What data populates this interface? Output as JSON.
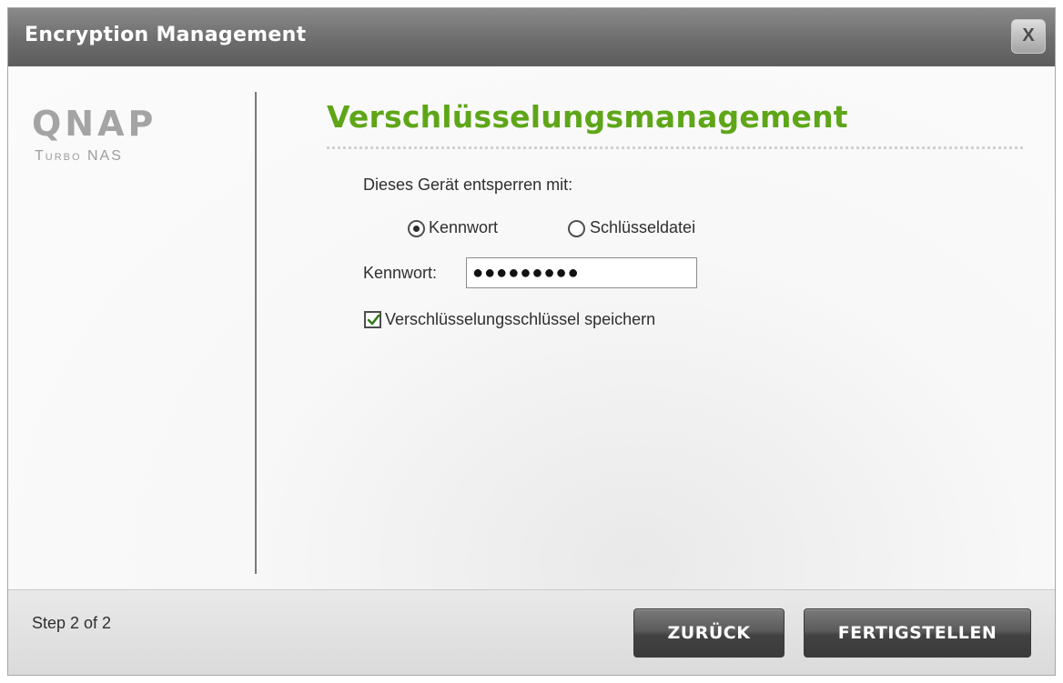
{
  "window": {
    "title": "Encryption Management",
    "close_label": "X"
  },
  "brand": {
    "logo_text": "QNAP",
    "subtitle": "Turbo NAS"
  },
  "main": {
    "heading": "Verschlüsselungsmanagement",
    "unlock_prompt": "Dieses Gerät entsperren mit:",
    "unlock_options": [
      {
        "label": "Kennwort",
        "selected": true
      },
      {
        "label": "Schlüsseldatei",
        "selected": false
      }
    ],
    "password_label": "Kennwort:",
    "password_value": "●●●●●●●●●",
    "save_key_label": "Verschlüsselungsschlüssel speichern",
    "save_key_checked": true
  },
  "footer": {
    "step_text": "Step 2 of 2",
    "back_label": "ZURÜCK",
    "finish_label": "FERTIGSTELLEN"
  },
  "colors": {
    "heading_green": "#5ea618",
    "titlebar_gray": "#6d6d6d",
    "button_dark": "#424242"
  }
}
